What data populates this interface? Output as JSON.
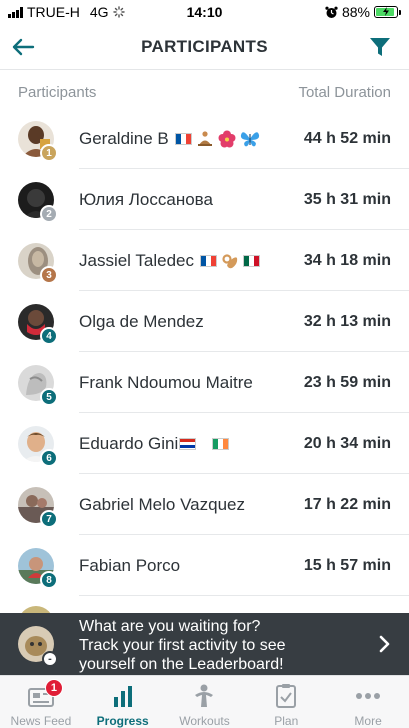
{
  "status_bar": {
    "carrier": "TRUE-H",
    "network": "4G",
    "time": "14:10",
    "battery": "88%",
    "battery_level": 0.88
  },
  "header": {
    "title": "PARTICIPANTS",
    "accent_color": "#0d6e7a"
  },
  "columns": {
    "participants": "Participants",
    "total_duration": "Total Duration"
  },
  "participants": [
    {
      "rank": "1",
      "name": "Geraldine B",
      "duration": "44 h 52 min",
      "rank_color": "#c9a45c"
    },
    {
      "rank": "2",
      "name": "Юлия Лоссанова",
      "duration": "35 h 31 min",
      "rank_color": "#a4abb2"
    },
    {
      "rank": "3",
      "name": "Jassiel Taledec",
      "duration": "34 h 18 min",
      "rank_color": "#b5764a"
    },
    {
      "rank": "4",
      "name": "Olga de Mendez",
      "duration": "32 h 13 min",
      "rank_color": "#0d6e7a"
    },
    {
      "rank": "5",
      "name": "Frank Ndoumou Maitre",
      "duration": "23 h 59 min",
      "rank_color": "#0d6e7a"
    },
    {
      "rank": "6",
      "name": "Eduardo Gini",
      "duration": "20 h 34 min",
      "rank_color": "#0d6e7a"
    },
    {
      "rank": "7",
      "name": "Gabriel Melo Vazquez",
      "duration": "17 h 22 min",
      "rank_color": "#0d6e7a"
    },
    {
      "rank": "8",
      "name": "Fabian Porco",
      "duration": "15 h 57 min",
      "rank_color": "#0d6e7a"
    }
  ],
  "banner": {
    "line1": "What are you waiting for?",
    "line2": "Track your first activity to see",
    "line3": "yourself on the Leaderboard!",
    "rank": "-"
  },
  "tabs": [
    {
      "label": "News Feed",
      "icon": "news-feed-icon",
      "badge": "1",
      "active": false
    },
    {
      "label": "Progress",
      "icon": "progress-icon",
      "active": true
    },
    {
      "label": "Workouts",
      "icon": "workouts-icon",
      "active": false
    },
    {
      "label": "Plan",
      "icon": "plan-icon",
      "active": false
    },
    {
      "label": "More",
      "icon": "more-icon",
      "active": false
    }
  ]
}
